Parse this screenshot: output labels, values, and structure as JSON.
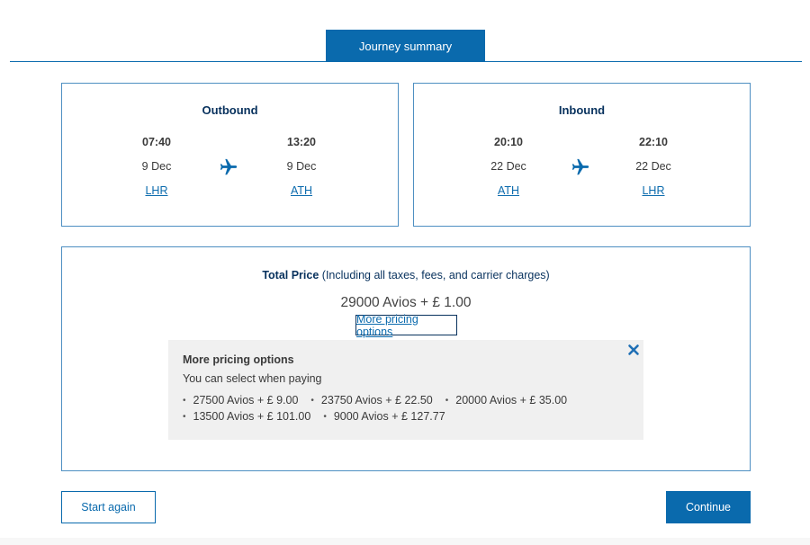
{
  "tabs": {
    "journey_summary": "Journey summary"
  },
  "outbound": {
    "title": "Outbound",
    "dep_time": "07:40",
    "dep_date": "9 Dec",
    "dep_code": "LHR",
    "arr_time": "13:20",
    "arr_date": "9 Dec",
    "arr_code": "ATH",
    "icon": "plane-icon"
  },
  "inbound": {
    "title": "Inbound",
    "dep_time": "20:10",
    "dep_date": "22 Dec",
    "dep_code": "ATH",
    "arr_time": "22:10",
    "arr_date": "22 Dec",
    "arr_code": "LHR",
    "icon": "plane-icon"
  },
  "price": {
    "total_label": "Total Price",
    "total_note": "(Including all taxes, fees, and carrier charges)",
    "main": "29000 Avios + £ 1.00",
    "more_link": "More pricing options"
  },
  "options": {
    "title": "More pricing options",
    "subtitle": "You can select when paying",
    "close_icon": "close-icon",
    "items": [
      "27500 Avios + £ 9.00",
      "23750 Avios + £ 22.50",
      "20000 Avios + £ 35.00",
      "13500 Avios + £ 101.00",
      "9000 Avios + £ 127.77"
    ]
  },
  "buttons": {
    "start_again": "Start again",
    "continue": "Continue"
  },
  "colors": {
    "brand_blue": "#0a6aad",
    "navy": "#07315d",
    "panel_border": "#4e8fc2",
    "options_bg": "#f0f0f0"
  }
}
